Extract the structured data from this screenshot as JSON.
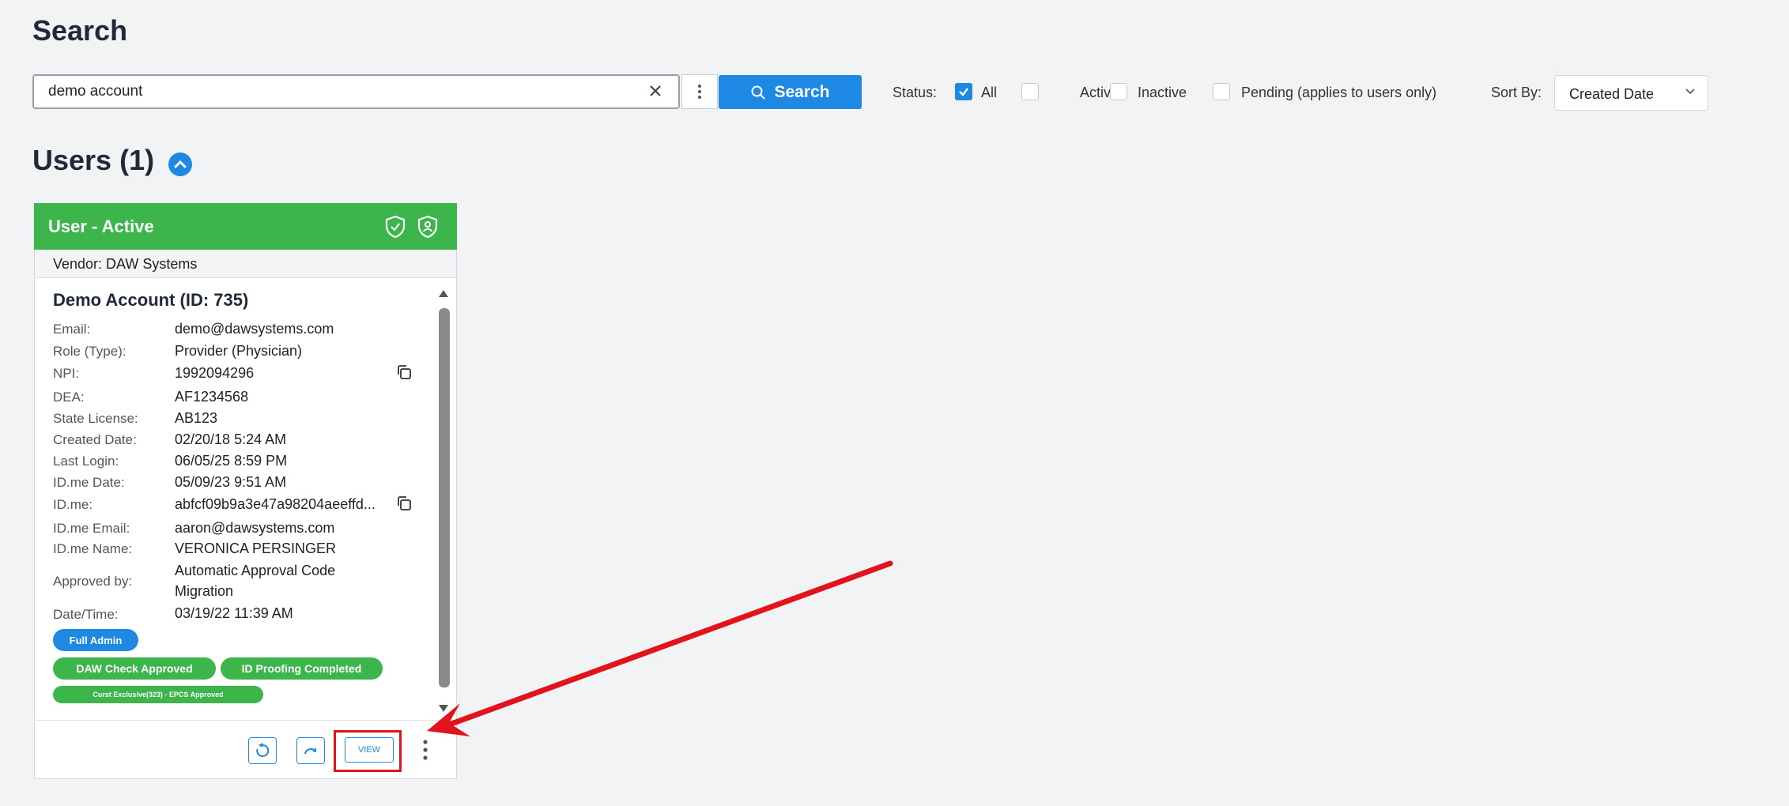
{
  "page": {
    "title": "Search"
  },
  "search": {
    "value": "demo account",
    "button_label": "Search"
  },
  "filters": {
    "status_label": "Status:",
    "options": [
      {
        "label": "All",
        "checked": true
      },
      {
        "label": "Active",
        "checked": false
      },
      {
        "label": "Inactive",
        "checked": false
      },
      {
        "label": "Pending (applies to users only)",
        "checked": false
      }
    ],
    "sort_label": "Sort By:",
    "sort_value": "Created Date"
  },
  "users_section": {
    "title": "Users (1)"
  },
  "card": {
    "header": "User - Active",
    "vendor": "Vendor: DAW Systems",
    "name": "Demo Account (ID: 735)",
    "fields": [
      {
        "label": "Email:",
        "value": "demo@dawsystems.com"
      },
      {
        "label": "Role (Type):",
        "value": "Provider (Physician)"
      },
      {
        "label": "NPI:",
        "value": "1992094296"
      },
      {
        "label": "DEA:",
        "value": "AF1234568"
      },
      {
        "label": "State License:",
        "value": "AB123"
      },
      {
        "label": "Created Date:",
        "value": "02/20/18 5:24 AM"
      },
      {
        "label": "Last Login:",
        "value": "06/05/25 8:59 PM"
      },
      {
        "label": "ID.me Date:",
        "value": "05/09/23 9:51 AM"
      },
      {
        "label": "ID.me:",
        "value": "abfcf09b9a3e47a98204aeeffd..."
      },
      {
        "label": "ID.me Email:",
        "value": "aaron@dawsystems.com"
      },
      {
        "label": "ID.me Name:",
        "value": "VERONICA PERSINGER"
      },
      {
        "label": "Approved by:",
        "value": [
          "Automatic Approval Code",
          "Migration"
        ]
      },
      {
        "label": "Date/Time:",
        "value": "03/19/22 11:39 AM"
      }
    ],
    "badges": {
      "role": "Full Admin",
      "status": [
        "DAW Check Approved",
        "ID Proofing Completed"
      ],
      "extra": "Curst Exclusive(323) - EPCS Approved"
    },
    "view_label": "VIEW"
  },
  "colors": {
    "accent": "#1e88e5",
    "active_green": "#3cb54a",
    "annotation_red": "#e1141b"
  }
}
